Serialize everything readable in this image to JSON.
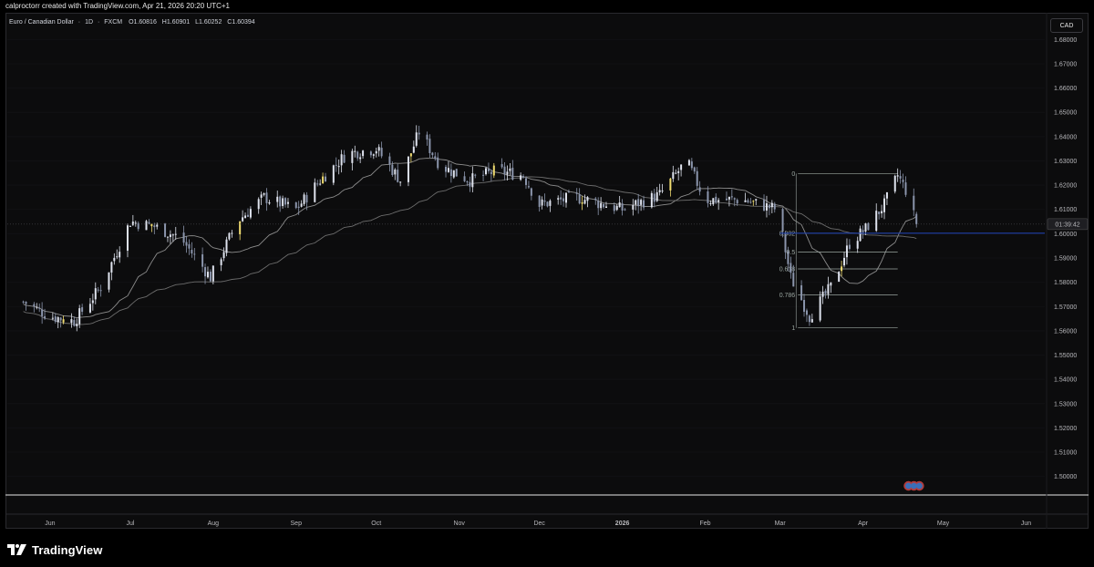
{
  "header": {
    "attribution": "calproctorr created with TradingView.com, Apr 21, 2026 20:20 UTC+1"
  },
  "legend": {
    "symbol": "Euro / Canadian Dollar",
    "sep1": "·",
    "interval": "1D",
    "sep2": "·",
    "source": "FXCM",
    "open_k": "O",
    "open_v": "1.60816",
    "high_k": "H",
    "high_v": "1.60901",
    "low_k": "L",
    "low_v": "1.60252",
    "close_k": "C",
    "close_v": "1.60394"
  },
  "currency_button": "CAD",
  "countdown": "01:39:42",
  "brand": {
    "name": "TradingView",
    "icon": "tradingview-logo-icon"
  },
  "colors": {
    "up": "#dfe3ee",
    "down": "#8b95ac",
    "highlight": "#f0dc70",
    "ma_fast": "#8c8c8c",
    "ma_slow": "#6c6c6c",
    "price_line": "#1f3fa8",
    "fib": "#9aa5a0"
  },
  "chart_data": {
    "type": "candlestick",
    "title": "",
    "ylim": [
      1.495,
      1.685
    ],
    "y_ticks": [
      "1.68000",
      "1.67000",
      "1.66000",
      "1.65000",
      "1.64000",
      "1.63000",
      "1.62000",
      "1.61000",
      "1.60000",
      "1.59000",
      "1.58000",
      "1.57000",
      "1.56000",
      "1.55000",
      "1.54000",
      "1.53000",
      "1.52000",
      "1.51000",
      "1.50000"
    ],
    "x_ticks": [
      "Jun",
      "Jul",
      "Aug",
      "Sep",
      "Oct",
      "Nov",
      "Dec",
      "2026",
      "Feb",
      "Mar",
      "Apr",
      "May",
      "Jun"
    ],
    "current_price": 1.60394,
    "horizontal_line": 1.6002,
    "fibonacci": [
      {
        "label": "0",
        "value": 1.6248
      },
      {
        "label": "0.382",
        "value": 1.6002
      },
      {
        "label": "0.5",
        "value": 1.5925
      },
      {
        "label": "0.618",
        "value": 1.5855
      },
      {
        "label": "0.786",
        "value": 1.5748
      },
      {
        "label": "1",
        "value": 1.5612
      }
    ],
    "close_series": [
      {
        "date": "2025-05-22",
        "close": 1.572
      },
      {
        "date": "2025-06-01",
        "close": 1.566
      },
      {
        "date": "2025-06-10",
        "close": 1.564
      },
      {
        "date": "2025-06-20",
        "close": 1.578
      },
      {
        "date": "2025-07-01",
        "close": 1.605
      },
      {
        "date": "2025-07-10",
        "close": 1.603
      },
      {
        "date": "2025-07-20",
        "close": 1.598
      },
      {
        "date": "2025-07-31",
        "close": 1.582
      },
      {
        "date": "2025-08-10",
        "close": 1.605
      },
      {
        "date": "2025-08-20",
        "close": 1.615
      },
      {
        "date": "2025-09-01",
        "close": 1.61
      },
      {
        "date": "2025-09-10",
        "close": 1.622
      },
      {
        "date": "2025-09-20",
        "close": 1.633
      },
      {
        "date": "2025-10-01",
        "close": 1.635
      },
      {
        "date": "2025-10-10",
        "close": 1.622
      },
      {
        "date": "2025-10-17",
        "close": 1.642
      },
      {
        "date": "2025-10-25",
        "close": 1.628
      },
      {
        "date": "2025-11-05",
        "close": 1.622
      },
      {
        "date": "2025-11-15",
        "close": 1.626
      },
      {
        "date": "2025-11-25",
        "close": 1.624
      },
      {
        "date": "2025-12-01",
        "close": 1.612
      },
      {
        "date": "2025-12-15",
        "close": 1.615
      },
      {
        "date": "2026-01-01",
        "close": 1.61
      },
      {
        "date": "2026-01-15",
        "close": 1.616
      },
      {
        "date": "2026-01-25",
        "close": 1.63
      },
      {
        "date": "2026-02-01",
        "close": 1.614
      },
      {
        "date": "2026-02-15",
        "close": 1.614
      },
      {
        "date": "2026-02-28",
        "close": 1.61
      },
      {
        "date": "2026-03-05",
        "close": 1.582
      },
      {
        "date": "2026-03-12",
        "close": 1.566
      },
      {
        "date": "2026-03-20",
        "close": 1.578
      },
      {
        "date": "2026-03-27",
        "close": 1.596
      },
      {
        "date": "2026-04-02",
        "close": 1.602
      },
      {
        "date": "2026-04-09",
        "close": 1.612
      },
      {
        "date": "2026-04-14",
        "close": 1.624
      },
      {
        "date": "2026-04-17",
        "close": 1.618
      },
      {
        "date": "2026-04-21",
        "close": 1.60394
      }
    ]
  }
}
